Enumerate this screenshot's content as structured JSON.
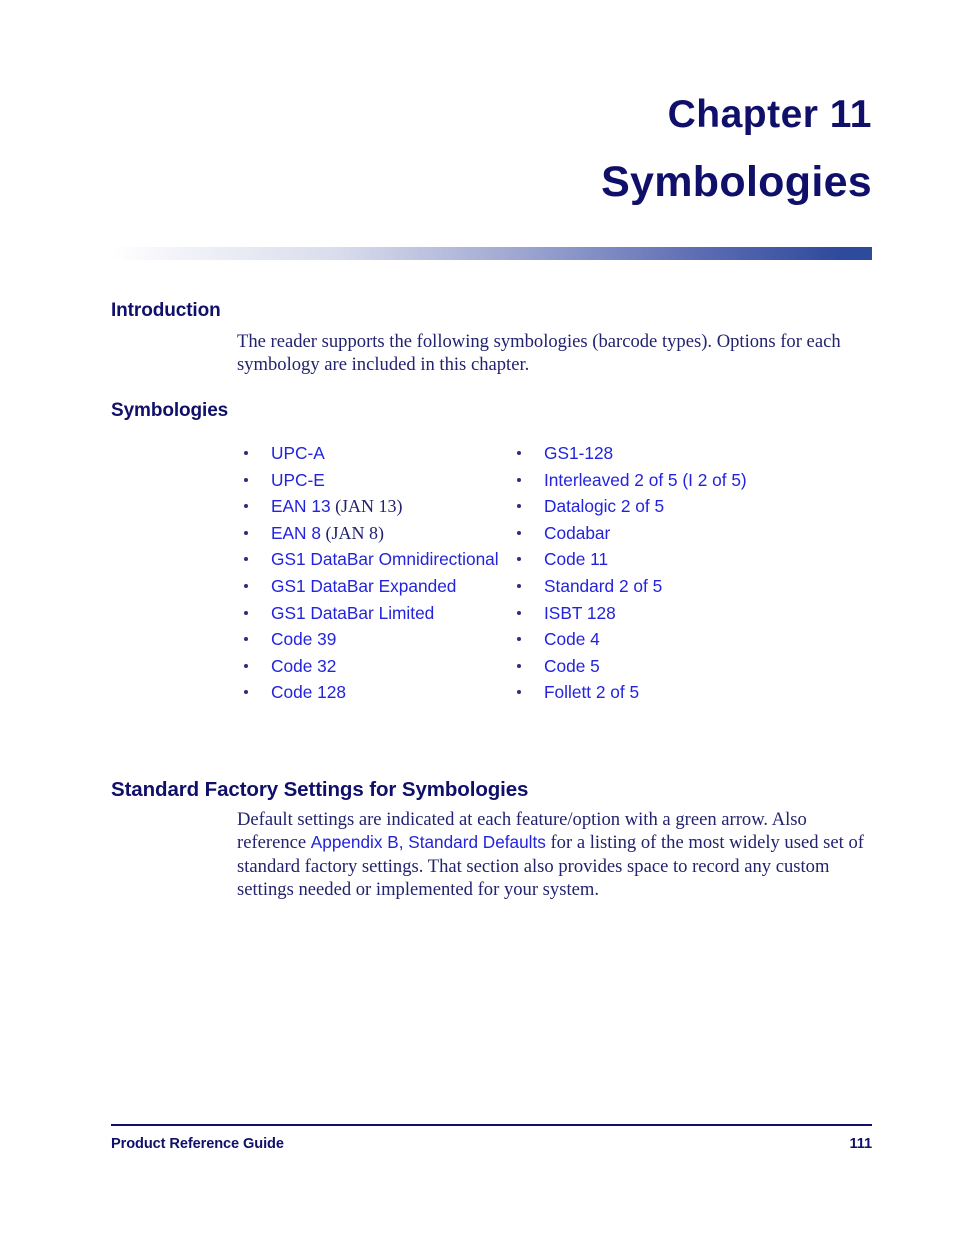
{
  "chapter": {
    "number": "Chapter 11",
    "title": "Symbologies"
  },
  "sections": {
    "introduction": {
      "heading": "Introduction",
      "paragraph": "The reader supports the following symbologies (barcode types). Options for each symbology are included in this chapter."
    },
    "symbologies": {
      "heading": "Symbologies",
      "left_column": [
        {
          "label": "UPC-A",
          "note": ""
        },
        {
          "label": "UPC-E",
          "note": ""
        },
        {
          "label": "EAN 13",
          "note": "(JAN 13)"
        },
        {
          "label": "EAN 8",
          "note": "(JAN 8)"
        },
        {
          "label": "GS1 DataBar Omnidirectional",
          "note": ""
        },
        {
          "label": "GS1 DataBar Expanded",
          "note": ""
        },
        {
          "label": "GS1 DataBar Limited",
          "note": ""
        },
        {
          "label": "Code 39",
          "note": ""
        },
        {
          "label": "Code 32",
          "note": ""
        },
        {
          "label": "Code 128",
          "note": ""
        }
      ],
      "right_column": [
        {
          "label": "GS1-128",
          "note": ""
        },
        {
          "label": "Interleaved 2 of 5 (I 2 of 5)",
          "note": ""
        },
        {
          "label": "Datalogic 2 of 5",
          "note": ""
        },
        {
          "label": "Codabar",
          "note": ""
        },
        {
          "label": "Code 11",
          "note": ""
        },
        {
          "label": "Standard 2 of 5",
          "note": ""
        },
        {
          "label": "ISBT 128",
          "note": ""
        },
        {
          "label": "Code 4",
          "note": ""
        },
        {
          "label": "Code 5",
          "note": ""
        },
        {
          "label": "Follett 2 of 5",
          "note": ""
        }
      ]
    },
    "factory_settings": {
      "heading": "Standard Factory Settings for Symbologies",
      "text_before_link": "Default settings are indicated at each feature/option with a green arrow. Also reference ",
      "link_text": "Appendix B, Standard Defaults",
      "text_after_link": " for a listing of the most widely used set of standard factory settings. That section also provides space to record any custom settings needed or implemented for your system."
    }
  },
  "footer": {
    "left": "Product Reference Guide",
    "page_number": "111"
  },
  "colors": {
    "navy": "#10106b",
    "body_navy": "#22226e",
    "link_blue": "#2323dd",
    "rule_blue_end": "#2e4a9c"
  }
}
